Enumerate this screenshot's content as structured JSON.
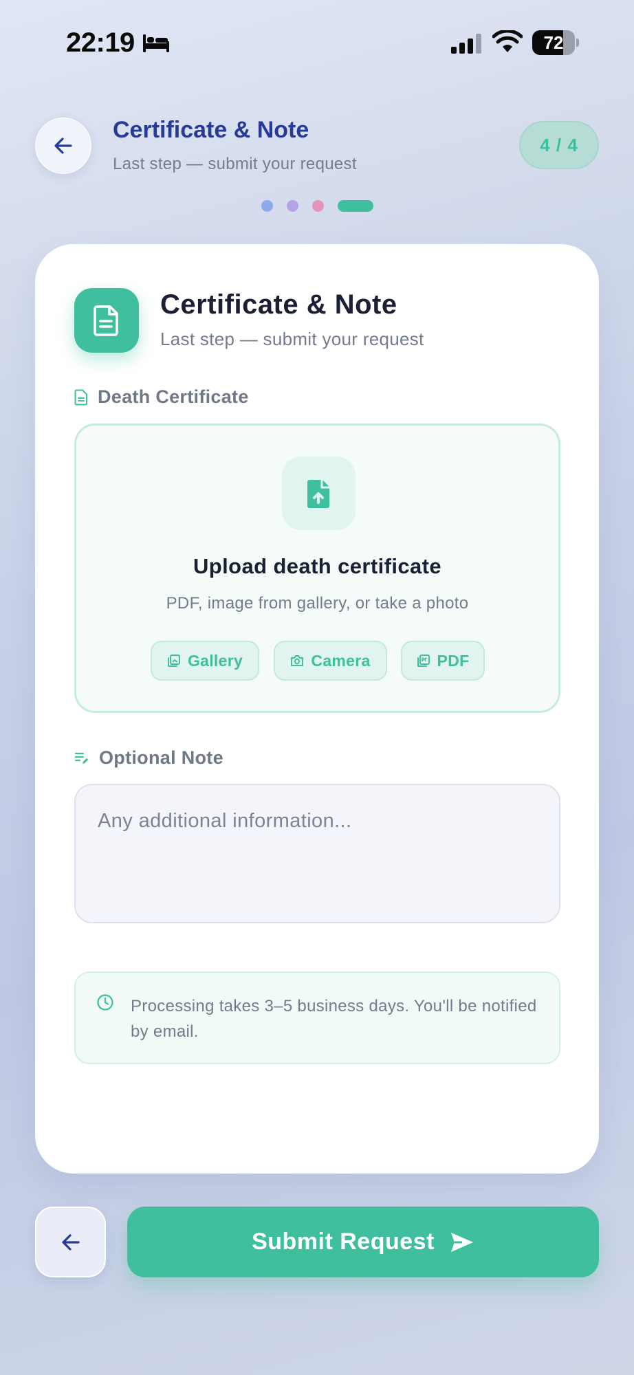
{
  "status_bar": {
    "time": "22:19",
    "battery_percent": 72,
    "battery_text": "72",
    "icons": [
      "bed-icon",
      "cellular-signal-icon",
      "wifi-icon",
      "battery-icon"
    ]
  },
  "header": {
    "title": "Certificate & Note",
    "subtitle": "Last step — submit your request",
    "step": "4 / 4",
    "step_dots": [
      {
        "color": "#8fa9ec",
        "active": false
      },
      {
        "color": "#b7a2ea",
        "active": false
      },
      {
        "color": "#e394b8",
        "active": false
      },
      {
        "color": "#3fbf9d",
        "active": true
      }
    ]
  },
  "card": {
    "title": "Certificate & Note",
    "subtitle": "Last step — submit your request",
    "certificate_label": "Death Certificate",
    "upload": {
      "title": "Upload death certificate",
      "subtitle": "PDF, image from gallery, or take a photo",
      "options": [
        {
          "label": "Gallery",
          "icon": "gallery-icon"
        },
        {
          "label": "Camera",
          "icon": "camera-icon"
        },
        {
          "label": "PDF",
          "icon": "pdf-icon"
        }
      ]
    },
    "note_label": "Optional Note",
    "note_placeholder": "Any additional information...",
    "note_value": "",
    "info_text": "Processing takes 3–5 business days. You'll be notified by email."
  },
  "actions": {
    "submit_label": "Submit Request"
  },
  "colors": {
    "accent": "#3fbf9d",
    "header_title": "#263a96",
    "text_dark": "#1b1f33",
    "text_muted": "#737b8c"
  }
}
